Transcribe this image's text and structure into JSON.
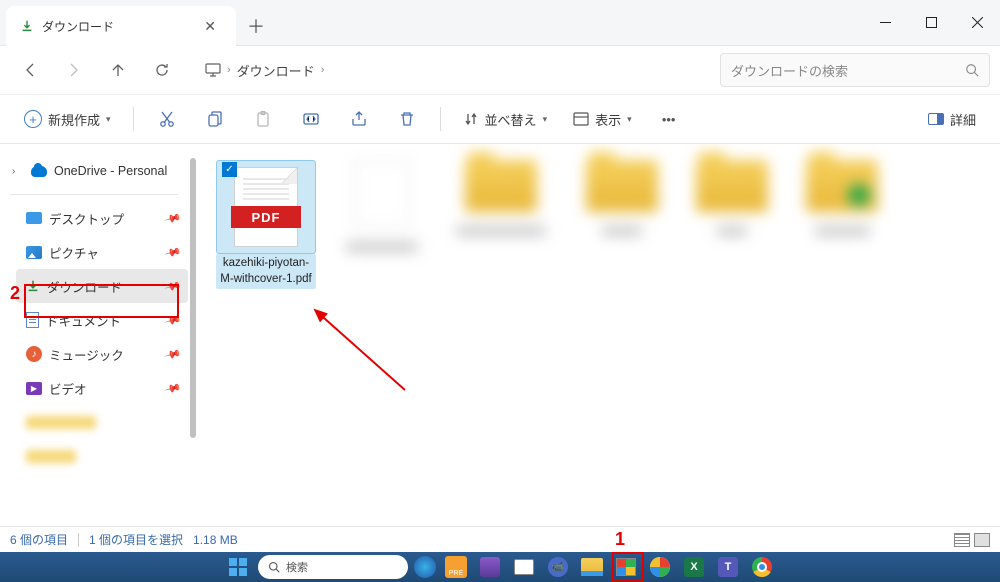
{
  "tab": {
    "title": "ダウンロード"
  },
  "breadcrumb": {
    "current": "ダウンロード"
  },
  "search": {
    "placeholder": "ダウンロードの検索"
  },
  "toolbar": {
    "new": "新規作成",
    "sort": "並べ替え",
    "view": "表示",
    "details": "詳細"
  },
  "sidebar": {
    "onedrive": "OneDrive - Personal",
    "quick": [
      {
        "label": "デスクトップ"
      },
      {
        "label": "ピクチャ"
      },
      {
        "label": "ダウンロード"
      },
      {
        "label": "ドキュメント"
      },
      {
        "label": "ミュージック"
      },
      {
        "label": "ビデオ"
      }
    ]
  },
  "files": {
    "selected": {
      "name": "kazehiki-piyotan-M-withcover-1.pdf",
      "badge": "PDF"
    }
  },
  "status": {
    "count": "6 個の項目",
    "selection": "1 個の項目を選択",
    "size": "1.18 MB"
  },
  "taskbar": {
    "search": "検索"
  },
  "annotations": {
    "one": "1",
    "two": "2"
  }
}
